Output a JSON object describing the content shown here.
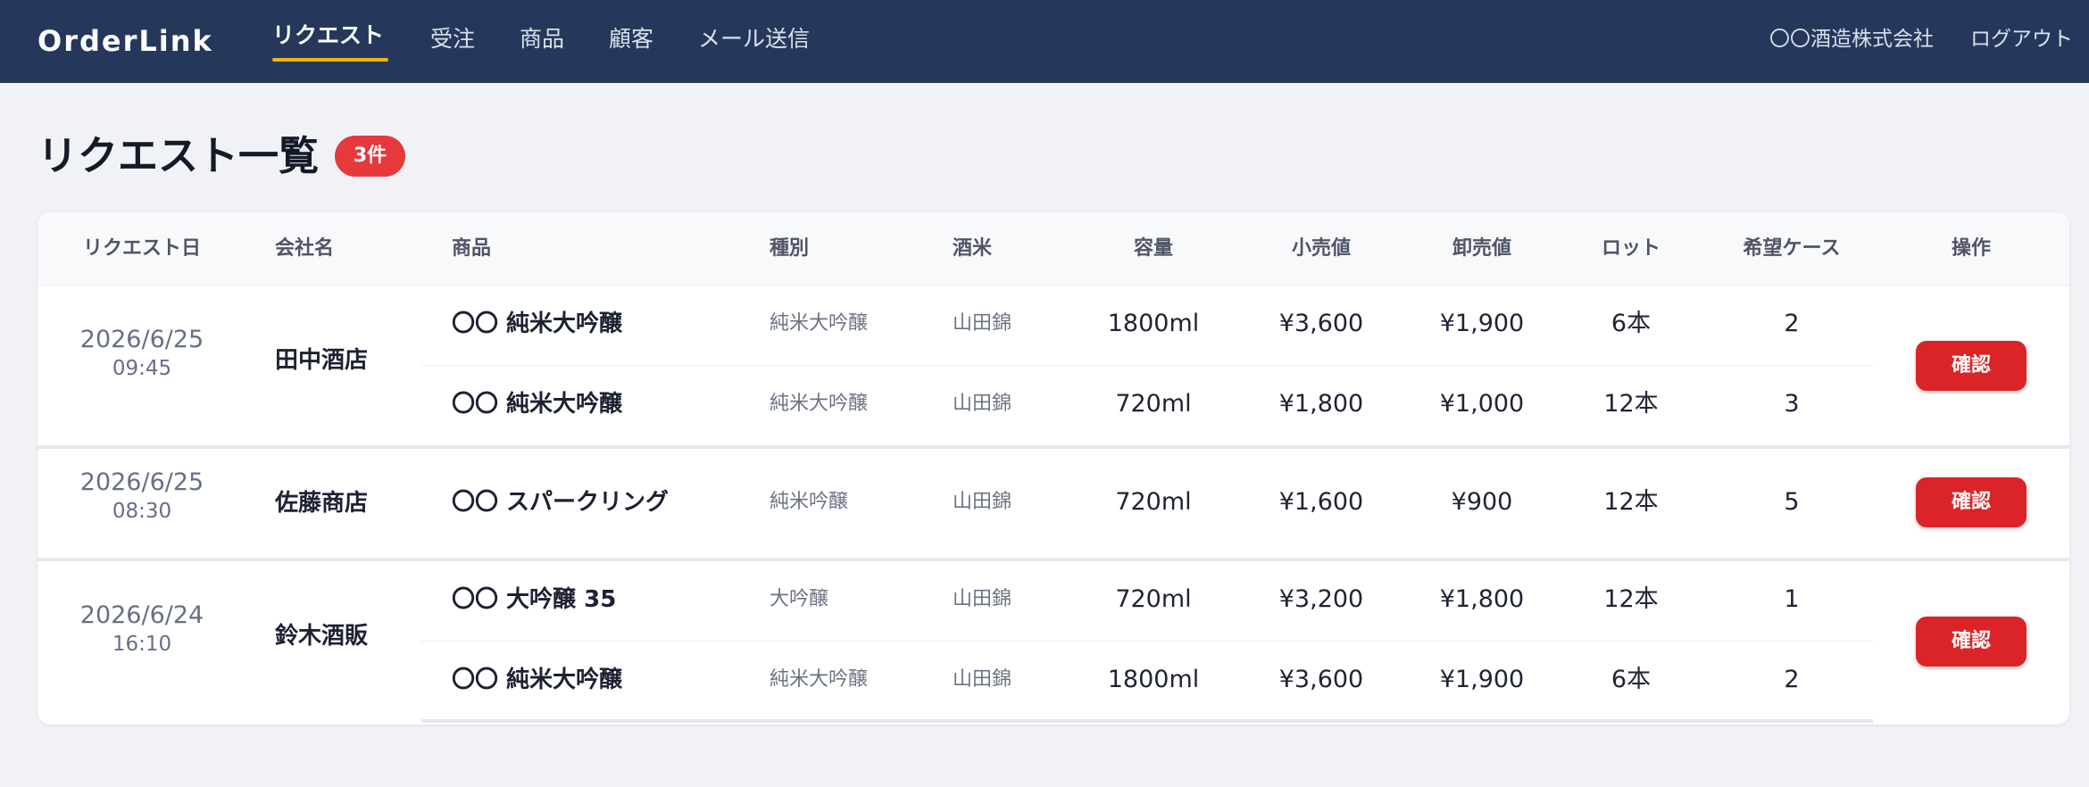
{
  "app": {
    "brand": "OrderLink",
    "nav": [
      {
        "label": "リクエスト",
        "active": true
      },
      {
        "label": "受注",
        "active": false
      },
      {
        "label": "商品",
        "active": false
      },
      {
        "label": "顧客",
        "active": false
      },
      {
        "label": "メール送信",
        "active": false
      }
    ],
    "company": "〇〇酒造株式会社",
    "logout": "ログアウト"
  },
  "page": {
    "title": "リクエスト一覧",
    "count_badge": "3件"
  },
  "table": {
    "headers": [
      "リクエスト日",
      "会社名",
      "商品",
      "種別",
      "酒米",
      "容量",
      "小売値",
      "卸売値",
      "ロット",
      "希望ケース",
      "操作"
    ],
    "groups": [
      {
        "date": "2026/6/25",
        "time": "09:45",
        "company": "田中酒店",
        "action": "確認",
        "items": [
          {
            "product": "〇〇 純米大吟醸",
            "kind": "純米大吟醸",
            "rice": "山田錦",
            "volume": "1800ml",
            "retail": "¥3,600",
            "wholesale": "¥1,900",
            "lot": "6本",
            "cases": "2"
          },
          {
            "product": "〇〇 純米大吟醸",
            "kind": "純米大吟醸",
            "rice": "山田錦",
            "volume": "720ml",
            "retail": "¥1,800",
            "wholesale": "¥1,000",
            "lot": "12本",
            "cases": "3"
          }
        ]
      },
      {
        "date": "2026/6/25",
        "time": "08:30",
        "company": "佐藤商店",
        "action": "確認",
        "items": [
          {
            "product": "〇〇 スパークリング",
            "kind": "純米吟醸",
            "rice": "山田錦",
            "volume": "720ml",
            "retail": "¥1,600",
            "wholesale": "¥900",
            "lot": "12本",
            "cases": "5"
          }
        ]
      },
      {
        "date": "2026/6/24",
        "time": "16:10",
        "company": "鈴木酒販",
        "action": "確認",
        "items": [
          {
            "product": "〇〇 大吟醸 35",
            "kind": "大吟醸",
            "rice": "山田錦",
            "volume": "720ml",
            "retail": "¥3,200",
            "wholesale": "¥1,800",
            "lot": "12本",
            "cases": "1"
          },
          {
            "product": "〇〇 純米大吟醸",
            "kind": "純米大吟醸",
            "rice": "山田錦",
            "volume": "1800ml",
            "retail": "¥3,600",
            "wholesale": "¥1,900",
            "lot": "6本",
            "cases": "2"
          }
        ]
      }
    ]
  },
  "colors": {
    "header_bg": "#25385b",
    "nav_active_underline": "#f2b417",
    "badge_bg": "#e5393b",
    "button_bg": "#da2428",
    "page_bg": "#f1f2f5"
  }
}
